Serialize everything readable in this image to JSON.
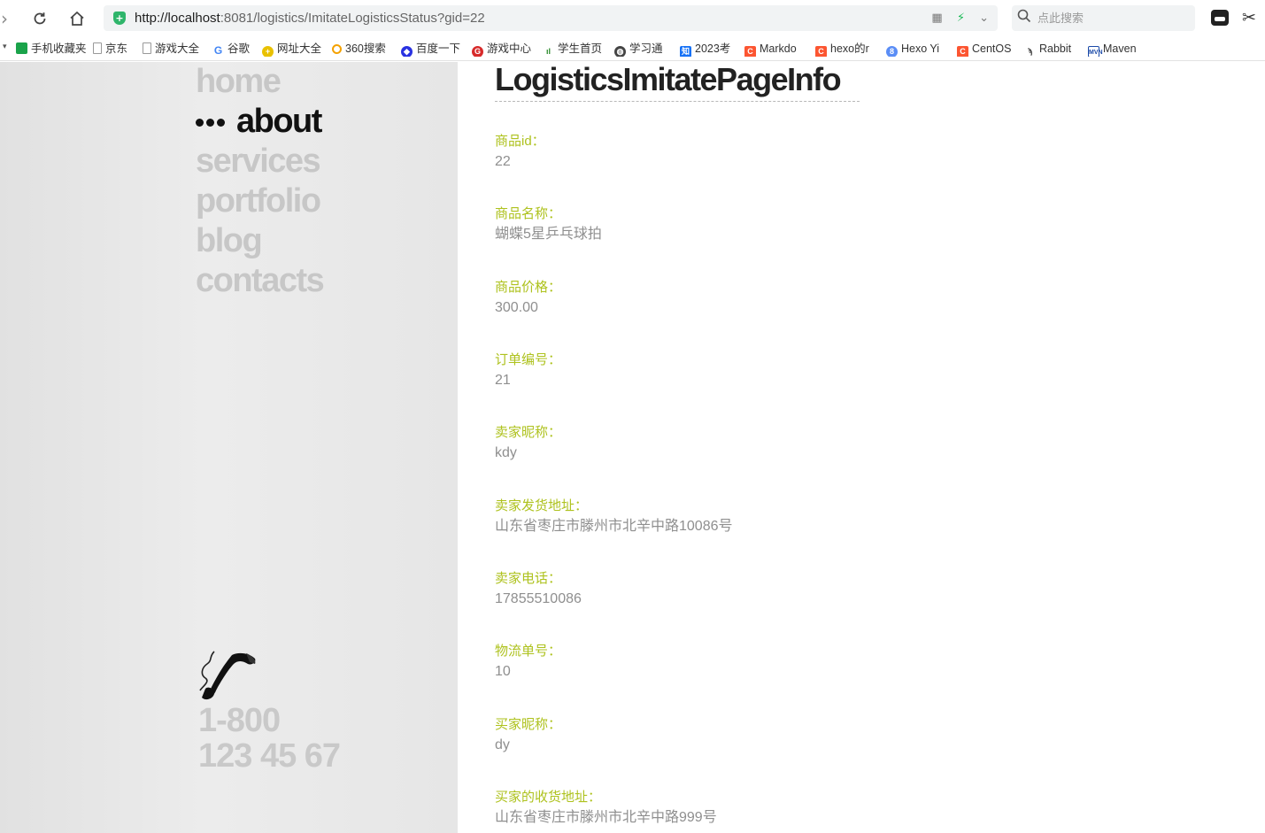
{
  "browser": {
    "url_host": "http://localhost",
    "url_rest": ":8081/logistics/ImitateLogisticsStatus?gid=22",
    "search_placeholder": "点此搜索"
  },
  "bookmarks": [
    {
      "label": "手机收藏夹",
      "icon": "phone-bookmark-icon"
    },
    {
      "label": "京东",
      "icon": "page-icon"
    },
    {
      "label": "游戏大全",
      "icon": "page-icon"
    },
    {
      "label": "谷歌",
      "icon": "google-icon"
    },
    {
      "label": "网址大全",
      "icon": "site-nav-icon"
    },
    {
      "label": "360搜索",
      "icon": "search-360-icon"
    },
    {
      "label": "百度一下",
      "icon": "baidu-paw-icon"
    },
    {
      "label": "游戏中心",
      "icon": "game-center-icon"
    },
    {
      "label": "学生首页",
      "icon": "signal-bars-icon"
    },
    {
      "label": "学习通",
      "icon": "globe-icon"
    },
    {
      "label": "2023考",
      "icon": "zhihu-icon"
    },
    {
      "label": "Markdo",
      "icon": "csdn-icon"
    },
    {
      "label": "hexo的r",
      "icon": "csdn-icon"
    },
    {
      "label": "Hexo Yi",
      "icon": "hexo-icon"
    },
    {
      "label": "CentOS",
      "icon": "csdn-icon"
    },
    {
      "label": "Rabbit",
      "icon": "rabbit-icon"
    },
    {
      "label": "Maven",
      "icon": "maven-icon"
    }
  ],
  "sidebar": {
    "menu": [
      "home",
      "about",
      "services",
      "portfolio",
      "blog",
      "contacts"
    ],
    "active_index": 1,
    "phone_line1": "1-800",
    "phone_line2": "123 45 67"
  },
  "main": {
    "title": "LogisticsImitatePageInfo",
    "fields": [
      {
        "label": "商品id：",
        "value": "22"
      },
      {
        "label": "商品名称：",
        "value": "蝴蝶5星乒乓球拍"
      },
      {
        "label": "商品价格：",
        "value": "300.00"
      },
      {
        "label": "订单编号：",
        "value": "21"
      },
      {
        "label": "卖家昵称：",
        "value": "kdy"
      },
      {
        "label": "卖家发货地址：",
        "value": "山东省枣庄市滕州市北辛中路10086号"
      },
      {
        "label": "卖家电话：",
        "value": "17855510086"
      },
      {
        "label": "物流单号：",
        "value": "10"
      },
      {
        "label": "买家昵称：",
        "value": "dy"
      },
      {
        "label": "买家的收货地址：",
        "value": "山东省枣庄市滕州市北辛中路999号"
      }
    ]
  },
  "colors": {
    "label_accent": "#aec21e",
    "value_text": "#8f8f8f",
    "menu_inactive": "#c7c7c7",
    "menu_active": "#111111"
  }
}
